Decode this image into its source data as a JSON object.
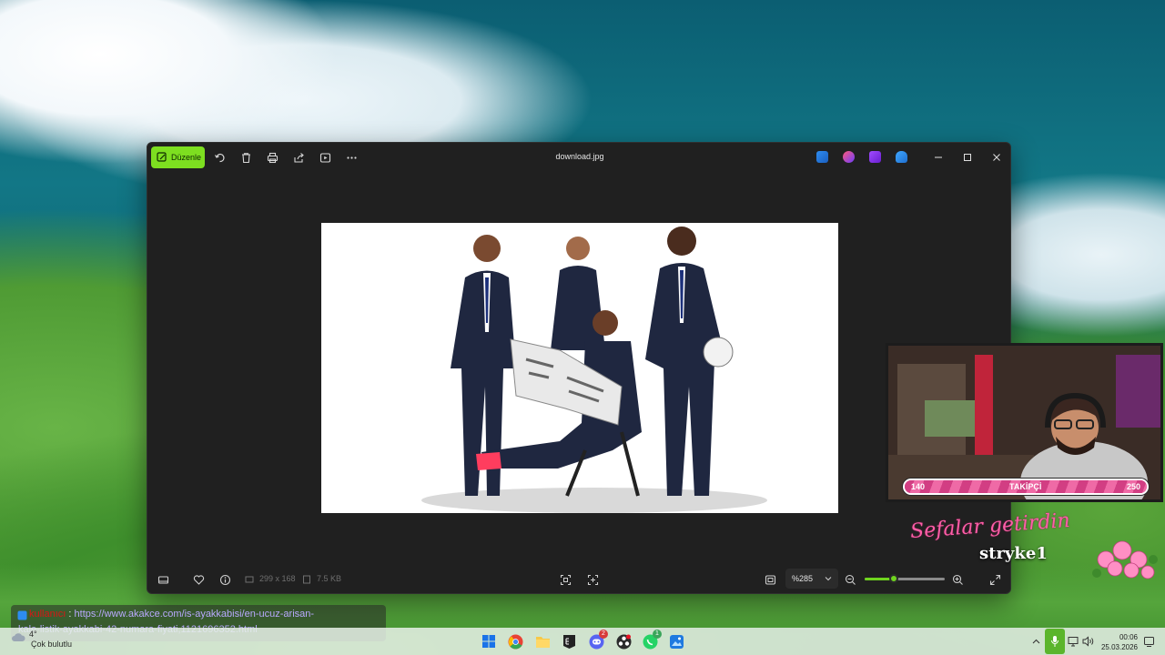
{
  "window": {
    "title": "download.jpg",
    "edit_label": "Düzenle",
    "image_dimensions": "299 x 168",
    "file_size": "7.5 KB",
    "zoom": "%285",
    "zoom_level_fraction": 0.36
  },
  "colors": {
    "accent": "#7ddf20",
    "window_bg": "#202020",
    "follower_bar": "#e24d8f"
  },
  "overlay": {
    "follower_min": "140",
    "follower_label": "TAKİPÇİ",
    "follower_max": "250",
    "script_text": "Sefalar getirdin",
    "streamer_name": "stryke1"
  },
  "chat": {
    "username": "kullanıcı",
    "url_line1": "https://www.akakce.com/is-ayakkabisi/en-ucuz-arisan-",
    "url_line2": "kale-listik-ayakkabi-42-numara-fiyati,1121696352.html"
  },
  "taskbar": {
    "weather": "Çok bulutlu",
    "weather_temp": "4°",
    "time": "00:06",
    "date": "25.03.2026",
    "discord_badge": "2",
    "whatsapp_badge": "1"
  },
  "icons": [
    "edit-icon",
    "rotate-icon",
    "delete-icon",
    "print-icon",
    "share-icon",
    "slideshow-icon",
    "more-icon",
    "minimize-icon",
    "maximize-icon",
    "close-icon",
    "filmstrip-icon",
    "favorite-icon",
    "info-icon",
    "zoom-out-icon",
    "zoom-in-icon",
    "fullscreen-icon"
  ]
}
